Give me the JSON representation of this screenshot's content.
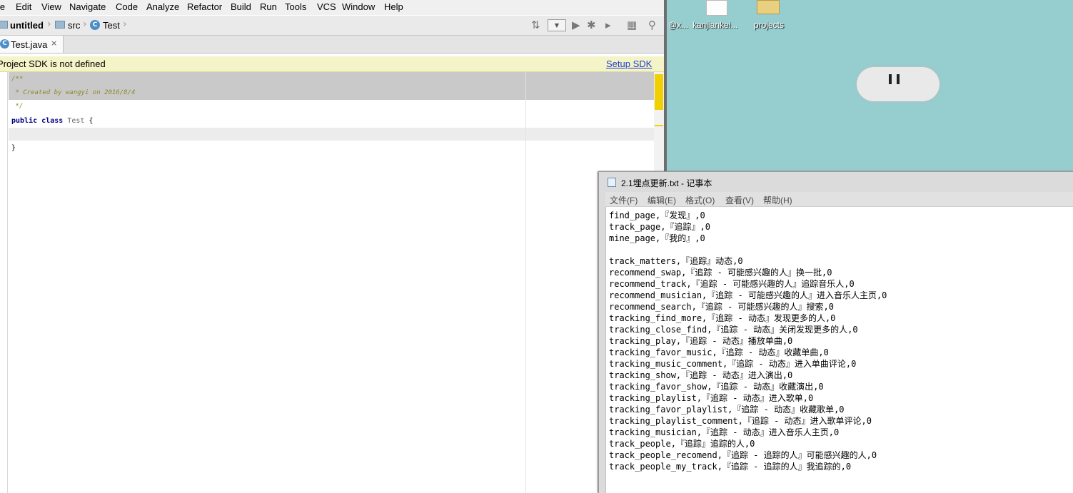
{
  "ide": {
    "menu": [
      "le",
      "Edit",
      "View",
      "Navigate",
      "Code",
      "Analyze",
      "Refactor",
      "Build",
      "Run",
      "Tools",
      "VCS",
      "Window",
      "Help"
    ],
    "breadcrumb": {
      "project": "untitled",
      "folder": "src",
      "file": "Test"
    },
    "tab": {
      "label": "Test.java",
      "close": "×"
    },
    "sdk_notice": {
      "message": "Project SDK is not defined",
      "link": "Setup SDK"
    },
    "code": {
      "comment_open": "/**",
      "comment_body": " * Created by wangyi on 2016/8/4",
      "comment_close": " */",
      "kw_public": "public",
      "kw_class": "class",
      "class_name": "Test",
      "brace_open": "{",
      "brace_close": "}"
    },
    "toolbar_icons": [
      "build-icon",
      "run-icon",
      "debug-icon",
      "coverage-icon",
      "structure-icon",
      "search-icon"
    ]
  },
  "desktop": {
    "icons": [
      {
        "label": "@x..."
      },
      {
        "label": "kanjiankei..."
      },
      {
        "label": "projects"
      }
    ]
  },
  "notepad": {
    "title": "2.1埋点更新.txt - 记事本",
    "menu": [
      "文件(F)",
      "编辑(E)",
      "格式(O)",
      "查看(V)",
      "帮助(H)"
    ],
    "lines": [
      "find_page,『发现』,0",
      "track_page,『追踪』,0",
      "mine_page,『我的』,0",
      "",
      "track_matters,『追踪』动态,0",
      "recommend_swap,『追踪 - 可能感兴趣的人』换一批,0",
      "recommend_track,『追踪 - 可能感兴趣的人』追踪音乐人,0",
      "recommend_musician,『追踪 - 可能感兴趣的人』进入音乐人主页,0",
      "recommend_search,『追踪 - 可能感兴趣的人』搜索,0",
      "tracking_find_more,『追踪 - 动态』发现更多的人,0",
      "tracking_close_find,『追踪 - 动态』关闭发现更多的人,0",
      "tracking_play,『追踪 - 动态』播放单曲,0",
      "tracking_favor_music,『追踪 - 动态』收藏单曲,0",
      "tracking_music_comment,『追踪 - 动态』进入单曲评论,0",
      "tracking_show,『追踪 - 动态』进入演出,0",
      "tracking_favor_show,『追踪 - 动态』收藏演出,0",
      "tracking_playlist,『追踪 - 动态』进入歌单,0",
      "tracking_favor_playlist,『追踪 - 动态』收藏歌单,0",
      "tracking_playlist_comment,『追踪 - 动态』进入歌单评论,0",
      "tracking_musician,『追踪 - 动态』进入音乐人主页,0",
      "track_people,『追踪』追踪的人,0",
      "track_people_recomend,『追踪 - 追踪的人』可能感兴趣的人,0",
      "track_people_my_track,『追踪 - 追踪的人』我追踪的,0"
    ]
  }
}
